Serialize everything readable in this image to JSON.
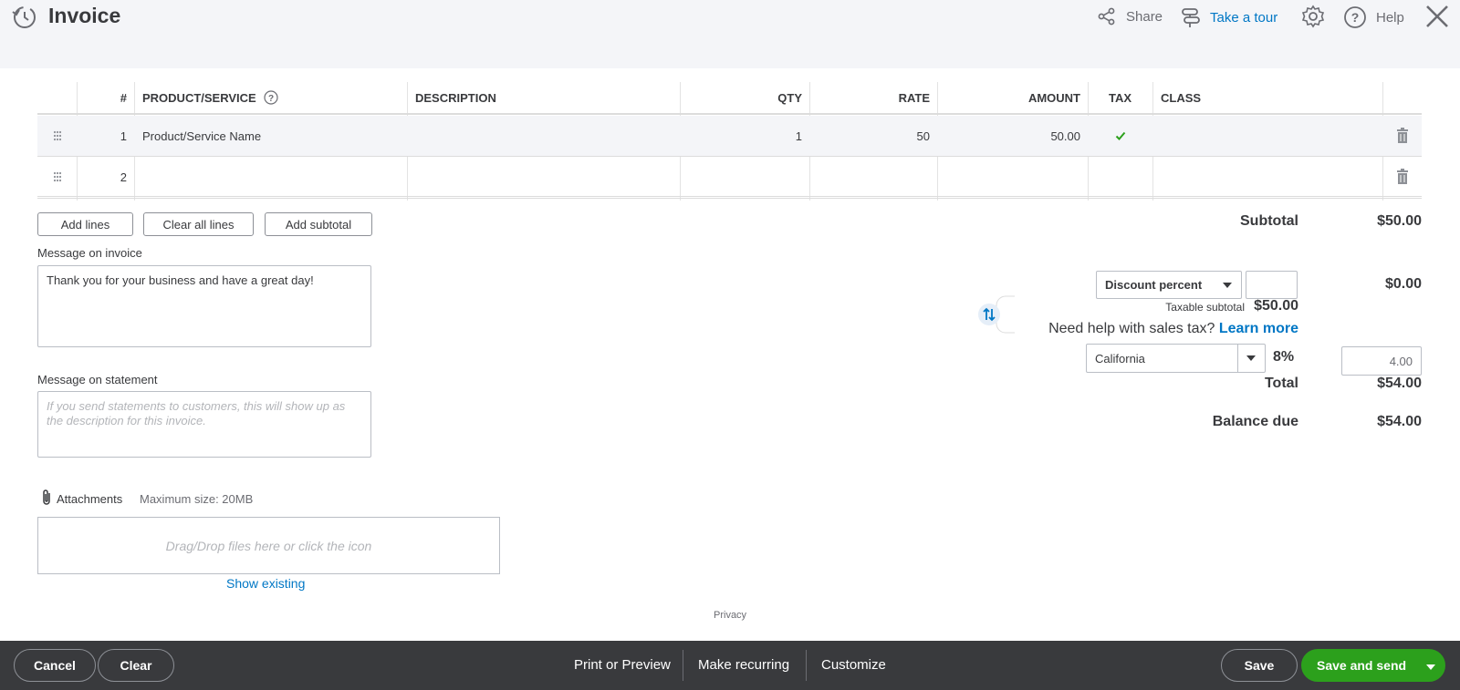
{
  "header": {
    "title": "Invoice",
    "share_label": "Share",
    "tour_label": "Take a tour",
    "help_label": "Help"
  },
  "table": {
    "columns": [
      "#",
      "PRODUCT/SERVICE",
      "DESCRIPTION",
      "QTY",
      "RATE",
      "AMOUNT",
      "TAX",
      "CLASS"
    ],
    "rows": [
      {
        "num": "1",
        "product": "Product/Service Name",
        "description": "",
        "qty": "1",
        "rate": "50",
        "amount": "50.00",
        "class": ""
      },
      {
        "num": "2",
        "product": "",
        "description": "",
        "qty": "",
        "rate": "",
        "amount": "",
        "class": ""
      }
    ]
  },
  "actions": {
    "add_lines": "Add lines",
    "clear_all_lines": "Clear all lines",
    "add_subtotal": "Add subtotal"
  },
  "messages": {
    "invoice_label": "Message on invoice",
    "invoice_value": "Thank you for your business and have a great day!",
    "statement_label": "Message on statement",
    "statement_placeholder": "If you send statements to customers, this will show up as the description for this invoice."
  },
  "attachments": {
    "label": "Attachments",
    "max_size": "Maximum size: 20MB",
    "drop_text": "Drag/Drop files here or click the icon",
    "show_existing": "Show existing"
  },
  "totals": {
    "subtotal_label": "Subtotal",
    "subtotal_value": "$50.00",
    "discount_type": "Discount percent",
    "discount_input": "",
    "discount_value": "$0.00",
    "taxable_subtotal_label": "Taxable subtotal",
    "taxable_subtotal_value": "$50.00",
    "sales_tax_help": "Need help with sales tax?",
    "learn_more": "Learn more",
    "tax_region": "California",
    "tax_rate": "8%",
    "tax_amount": "4.00",
    "total_label": "Total",
    "total_value": "$54.00",
    "balance_due_label": "Balance due",
    "balance_due_value": "$54.00"
  },
  "privacy": "Privacy",
  "footer": {
    "cancel": "Cancel",
    "clear": "Clear",
    "print_preview": "Print or Preview",
    "make_recurring": "Make recurring",
    "customize": "Customize",
    "save": "Save",
    "save_and_send": "Save and send"
  },
  "colors": {
    "brand_green": "#2ca01c",
    "link_blue": "#0077c5",
    "footer_bg": "#393a3d",
    "header_bg": "#f4f5f8"
  }
}
